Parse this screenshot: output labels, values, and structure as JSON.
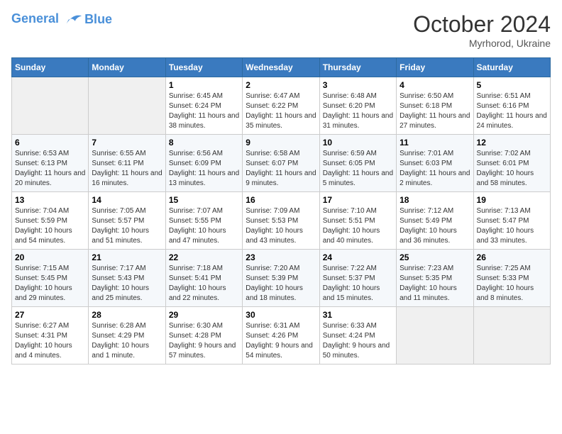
{
  "header": {
    "logo_line1": "General",
    "logo_line2": "Blue",
    "month_title": "October 2024",
    "location": "Myrhorod, Ukraine"
  },
  "weekdays": [
    "Sunday",
    "Monday",
    "Tuesday",
    "Wednesday",
    "Thursday",
    "Friday",
    "Saturday"
  ],
  "weeks": [
    [
      {
        "day": "",
        "sunrise": "",
        "sunset": "",
        "daylight": ""
      },
      {
        "day": "",
        "sunrise": "",
        "sunset": "",
        "daylight": ""
      },
      {
        "day": "1",
        "sunrise": "Sunrise: 6:45 AM",
        "sunset": "Sunset: 6:24 PM",
        "daylight": "Daylight: 11 hours and 38 minutes."
      },
      {
        "day": "2",
        "sunrise": "Sunrise: 6:47 AM",
        "sunset": "Sunset: 6:22 PM",
        "daylight": "Daylight: 11 hours and 35 minutes."
      },
      {
        "day": "3",
        "sunrise": "Sunrise: 6:48 AM",
        "sunset": "Sunset: 6:20 PM",
        "daylight": "Daylight: 11 hours and 31 minutes."
      },
      {
        "day": "4",
        "sunrise": "Sunrise: 6:50 AM",
        "sunset": "Sunset: 6:18 PM",
        "daylight": "Daylight: 11 hours and 27 minutes."
      },
      {
        "day": "5",
        "sunrise": "Sunrise: 6:51 AM",
        "sunset": "Sunset: 6:16 PM",
        "daylight": "Daylight: 11 hours and 24 minutes."
      }
    ],
    [
      {
        "day": "6",
        "sunrise": "Sunrise: 6:53 AM",
        "sunset": "Sunset: 6:13 PM",
        "daylight": "Daylight: 11 hours and 20 minutes."
      },
      {
        "day": "7",
        "sunrise": "Sunrise: 6:55 AM",
        "sunset": "Sunset: 6:11 PM",
        "daylight": "Daylight: 11 hours and 16 minutes."
      },
      {
        "day": "8",
        "sunrise": "Sunrise: 6:56 AM",
        "sunset": "Sunset: 6:09 PM",
        "daylight": "Daylight: 11 hours and 13 minutes."
      },
      {
        "day": "9",
        "sunrise": "Sunrise: 6:58 AM",
        "sunset": "Sunset: 6:07 PM",
        "daylight": "Daylight: 11 hours and 9 minutes."
      },
      {
        "day": "10",
        "sunrise": "Sunrise: 6:59 AM",
        "sunset": "Sunset: 6:05 PM",
        "daylight": "Daylight: 11 hours and 5 minutes."
      },
      {
        "day": "11",
        "sunrise": "Sunrise: 7:01 AM",
        "sunset": "Sunset: 6:03 PM",
        "daylight": "Daylight: 11 hours and 2 minutes."
      },
      {
        "day": "12",
        "sunrise": "Sunrise: 7:02 AM",
        "sunset": "Sunset: 6:01 PM",
        "daylight": "Daylight: 10 hours and 58 minutes."
      }
    ],
    [
      {
        "day": "13",
        "sunrise": "Sunrise: 7:04 AM",
        "sunset": "Sunset: 5:59 PM",
        "daylight": "Daylight: 10 hours and 54 minutes."
      },
      {
        "day": "14",
        "sunrise": "Sunrise: 7:05 AM",
        "sunset": "Sunset: 5:57 PM",
        "daylight": "Daylight: 10 hours and 51 minutes."
      },
      {
        "day": "15",
        "sunrise": "Sunrise: 7:07 AM",
        "sunset": "Sunset: 5:55 PM",
        "daylight": "Daylight: 10 hours and 47 minutes."
      },
      {
        "day": "16",
        "sunrise": "Sunrise: 7:09 AM",
        "sunset": "Sunset: 5:53 PM",
        "daylight": "Daylight: 10 hours and 43 minutes."
      },
      {
        "day": "17",
        "sunrise": "Sunrise: 7:10 AM",
        "sunset": "Sunset: 5:51 PM",
        "daylight": "Daylight: 10 hours and 40 minutes."
      },
      {
        "day": "18",
        "sunrise": "Sunrise: 7:12 AM",
        "sunset": "Sunset: 5:49 PM",
        "daylight": "Daylight: 10 hours and 36 minutes."
      },
      {
        "day": "19",
        "sunrise": "Sunrise: 7:13 AM",
        "sunset": "Sunset: 5:47 PM",
        "daylight": "Daylight: 10 hours and 33 minutes."
      }
    ],
    [
      {
        "day": "20",
        "sunrise": "Sunrise: 7:15 AM",
        "sunset": "Sunset: 5:45 PM",
        "daylight": "Daylight: 10 hours and 29 minutes."
      },
      {
        "day": "21",
        "sunrise": "Sunrise: 7:17 AM",
        "sunset": "Sunset: 5:43 PM",
        "daylight": "Daylight: 10 hours and 25 minutes."
      },
      {
        "day": "22",
        "sunrise": "Sunrise: 7:18 AM",
        "sunset": "Sunset: 5:41 PM",
        "daylight": "Daylight: 10 hours and 22 minutes."
      },
      {
        "day": "23",
        "sunrise": "Sunrise: 7:20 AM",
        "sunset": "Sunset: 5:39 PM",
        "daylight": "Daylight: 10 hours and 18 minutes."
      },
      {
        "day": "24",
        "sunrise": "Sunrise: 7:22 AM",
        "sunset": "Sunset: 5:37 PM",
        "daylight": "Daylight: 10 hours and 15 minutes."
      },
      {
        "day": "25",
        "sunrise": "Sunrise: 7:23 AM",
        "sunset": "Sunset: 5:35 PM",
        "daylight": "Daylight: 10 hours and 11 minutes."
      },
      {
        "day": "26",
        "sunrise": "Sunrise: 7:25 AM",
        "sunset": "Sunset: 5:33 PM",
        "daylight": "Daylight: 10 hours and 8 minutes."
      }
    ],
    [
      {
        "day": "27",
        "sunrise": "Sunrise: 6:27 AM",
        "sunset": "Sunset: 4:31 PM",
        "daylight": "Daylight: 10 hours and 4 minutes."
      },
      {
        "day": "28",
        "sunrise": "Sunrise: 6:28 AM",
        "sunset": "Sunset: 4:29 PM",
        "daylight": "Daylight: 10 hours and 1 minute."
      },
      {
        "day": "29",
        "sunrise": "Sunrise: 6:30 AM",
        "sunset": "Sunset: 4:28 PM",
        "daylight": "Daylight: 9 hours and 57 minutes."
      },
      {
        "day": "30",
        "sunrise": "Sunrise: 6:31 AM",
        "sunset": "Sunset: 4:26 PM",
        "daylight": "Daylight: 9 hours and 54 minutes."
      },
      {
        "day": "31",
        "sunrise": "Sunrise: 6:33 AM",
        "sunset": "Sunset: 4:24 PM",
        "daylight": "Daylight: 9 hours and 50 minutes."
      },
      {
        "day": "",
        "sunrise": "",
        "sunset": "",
        "daylight": ""
      },
      {
        "day": "",
        "sunrise": "",
        "sunset": "",
        "daylight": ""
      }
    ]
  ]
}
